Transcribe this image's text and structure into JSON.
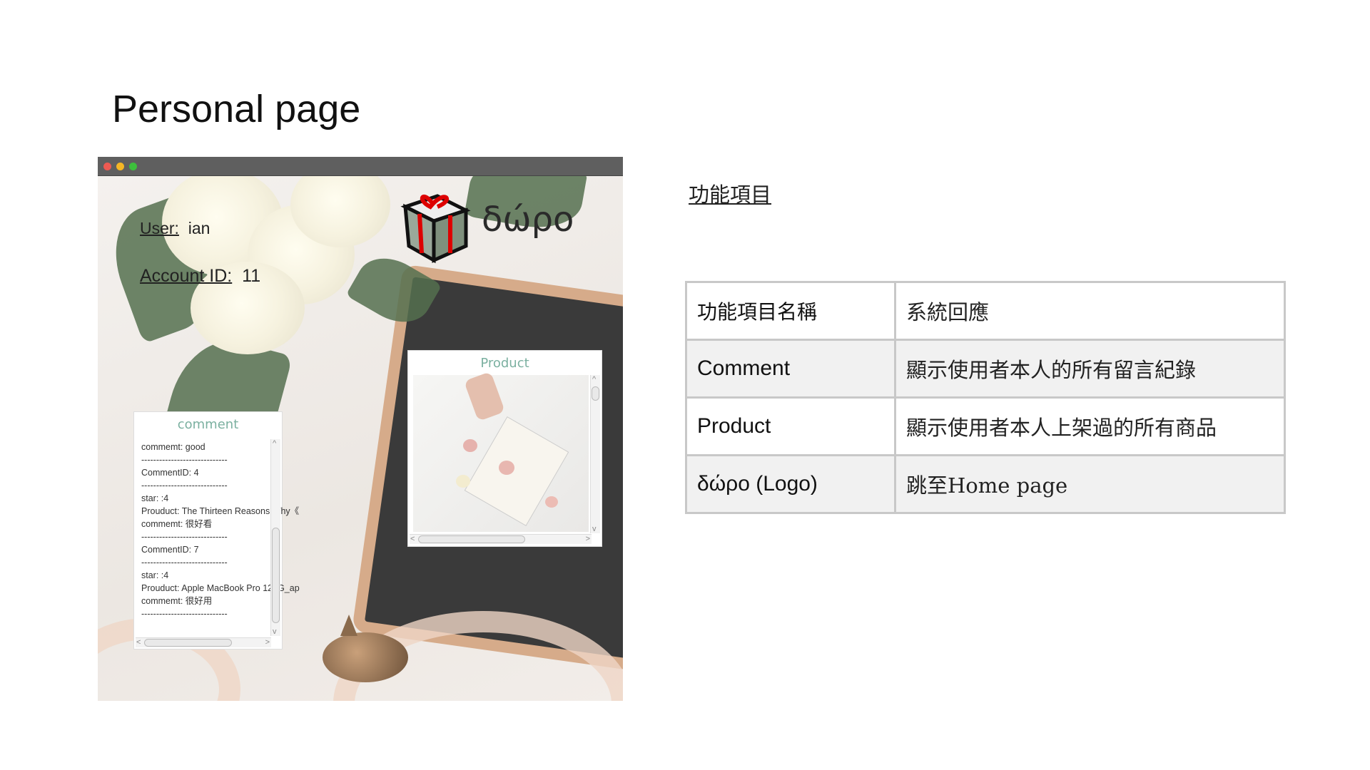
{
  "slide": {
    "title": "Personal page"
  },
  "app": {
    "user_label": "User:",
    "user_value": "ian",
    "account_label": "Account ID:",
    "account_value": "11",
    "logo_text": "δώρο",
    "comment_panel": {
      "title": "comment",
      "lines": [
        "commemt: good",
        "-----------------------------",
        "CommentID: 4",
        "-----------------------------",
        "star: :4",
        "Prouduct: The Thirteen Reasons Why《",
        "commemt: 很好看",
        "-----------------------------",
        "CommentID: 7",
        "-----------------------------",
        "star: :4",
        "Prouduct: Apple MacBook Pro 128G_ap",
        "commemt: 很好用",
        "-----------------------------"
      ]
    },
    "product_panel": {
      "title": "Product"
    },
    "window_controls": {
      "close": "#ee5a52",
      "minimize": "#f5b625",
      "zoom": "#3dbf3c"
    }
  },
  "features": {
    "heading": "功能項目",
    "table": {
      "headers": [
        "功能項目名稱",
        "系統回應"
      ],
      "rows": [
        [
          "Comment",
          "顯示使用者本人的所有留言紀錄"
        ],
        [
          "Product",
          "顯示使用者本人上架過的所有商品"
        ],
        [
          "δώρο (Logo)",
          "跳至Home page"
        ]
      ]
    }
  }
}
